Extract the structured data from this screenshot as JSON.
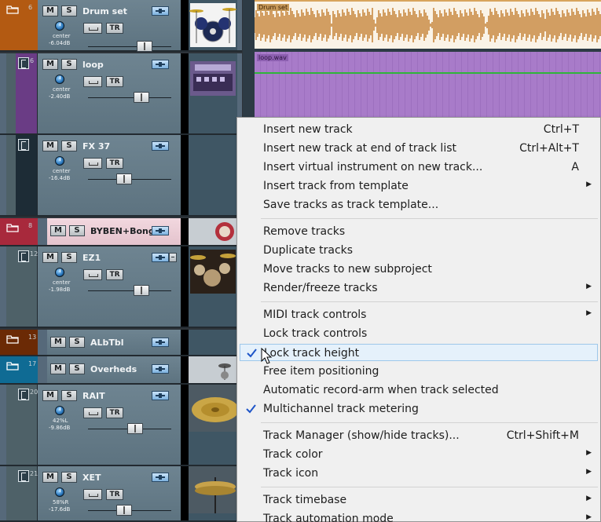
{
  "tracks": [
    {
      "num": "6",
      "name": "Drum set",
      "pan": "center",
      "volume": "-6.04dB",
      "fader_level": 0.72
    },
    {
      "num": "6",
      "name": "loop",
      "pan": "center",
      "volume": "-2.40dB",
      "fader_level": 0.68
    },
    {
      "num": "",
      "name": "FX 37",
      "pan": "center",
      "volume": "-16.4dB",
      "fader_level": 0.42
    },
    {
      "num": "8",
      "name": "BYBEN+Bong",
      "pan": "",
      "volume": "",
      "fader_level": null
    },
    {
      "num": "12",
      "name": "EZ1",
      "pan": "center",
      "volume": "-1.98dB",
      "fader_level": 0.68
    },
    {
      "num": "13",
      "name": "ALbTbl",
      "pan": "",
      "volume": "",
      "fader_level": null
    },
    {
      "num": "17",
      "name": "Overheds",
      "pan": "",
      "volume": "",
      "fader_level": null
    },
    {
      "num": "20",
      "name": "RAIT",
      "pan": "42%L",
      "volume": "-9.86dB",
      "fader_level": 0.58
    },
    {
      "num": "21",
      "name": "XET",
      "pan": "58%R",
      "volume": "-17.6dB",
      "fader_level": 0.42
    }
  ],
  "buttons": {
    "mute": "M",
    "solo": "S",
    "io": "⊥⊥",
    "tr": "TR"
  },
  "items": {
    "drum_set": "Drum set",
    "loop": "loop.wav"
  },
  "context_menu": {
    "groups": [
      [
        {
          "label": "Insert new track",
          "shortcut": "Ctrl+T",
          "submenu": false,
          "checked": false
        },
        {
          "label": "Insert new track at end of track list",
          "shortcut": "Ctrl+Alt+T",
          "submenu": false,
          "checked": false
        },
        {
          "label": "Insert virtual instrument on new track...",
          "shortcut": "A",
          "submenu": false,
          "checked": false
        },
        {
          "label": "Insert track from template",
          "shortcut": "",
          "submenu": true,
          "checked": false
        },
        {
          "label": "Save tracks as track template...",
          "shortcut": "",
          "submenu": false,
          "checked": false
        }
      ],
      [
        {
          "label": "Remove tracks",
          "shortcut": "",
          "submenu": false,
          "checked": false
        },
        {
          "label": "Duplicate tracks",
          "shortcut": "",
          "submenu": false,
          "checked": false
        },
        {
          "label": "Move tracks to new subproject",
          "shortcut": "",
          "submenu": false,
          "checked": false
        },
        {
          "label": "Render/freeze tracks",
          "shortcut": "",
          "submenu": true,
          "checked": false
        }
      ],
      [
        {
          "label": "MIDI track controls",
          "shortcut": "",
          "submenu": true,
          "checked": false
        },
        {
          "label": "Lock track controls",
          "shortcut": "",
          "submenu": false,
          "checked": false
        },
        {
          "label": "Lock track height",
          "shortcut": "",
          "submenu": false,
          "checked": true,
          "highlighted": true
        },
        {
          "label": "Free item positioning",
          "shortcut": "",
          "submenu": false,
          "checked": false
        },
        {
          "label": "Automatic record-arm when track selected",
          "shortcut": "",
          "submenu": false,
          "checked": false
        },
        {
          "label": "Multichannel track metering",
          "shortcut": "",
          "submenu": false,
          "checked": true
        }
      ],
      [
        {
          "label": "Track Manager (show/hide tracks)...",
          "shortcut": "Ctrl+Shift+M",
          "submenu": false,
          "checked": false
        },
        {
          "label": "Track color",
          "shortcut": "",
          "submenu": true,
          "checked": false
        },
        {
          "label": "Track icon",
          "shortcut": "",
          "submenu": true,
          "checked": false
        }
      ],
      [
        {
          "label": "Track timebase",
          "shortcut": "",
          "submenu": true,
          "checked": false
        },
        {
          "label": "Track automation mode",
          "shortcut": "",
          "submenu": true,
          "checked": false
        }
      ]
    ]
  },
  "colors": {
    "drum_folder": "#b35a12",
    "loop_stripe": "#6a3c85",
    "fx_stripe": "#1d2c36",
    "byben_folder": "#a8293c",
    "ez1_stripe": "#4e6168",
    "albtbl_folder": "#6b2a05",
    "overheds_folder": "#0f6b94",
    "rait_stripe": "#4e6168",
    "xet_stripe": "#4e6168",
    "check_blue": "#1e55c8",
    "menu_highlight": "#e5f1fb"
  }
}
